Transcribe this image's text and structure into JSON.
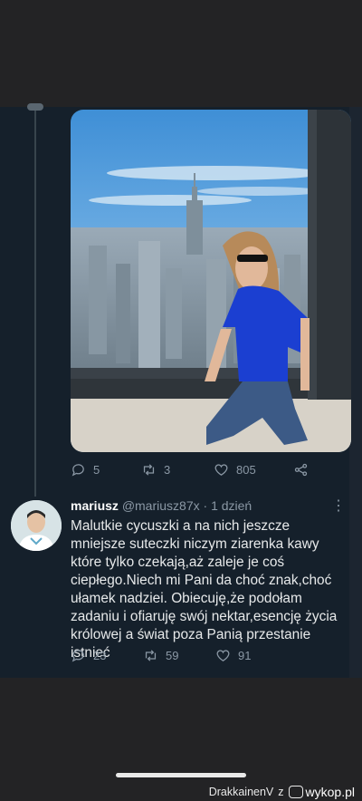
{
  "tweet_top": {
    "photo_alt": "woman-sitting-at-window-over-city",
    "actions": [
      {
        "icon": "reply-icon",
        "count": "5"
      },
      {
        "icon": "retweet-icon",
        "count": "3"
      },
      {
        "icon": "like-icon",
        "count": "805"
      },
      {
        "icon": "share-icon",
        "count": ""
      }
    ]
  },
  "tweet_reply": {
    "name": "mariusz",
    "handle": "@mariusz87x",
    "separator": " · ",
    "time": "1 dzień",
    "more": "⋮",
    "text": "Malutkie cycuszki a na nich jeszcze mniejsze suteczki niczym ziarenka kawy które tylko czekają,aż zaleje je coś ciepłego.Niech mi Pani da choć znak,choć ułamek nadziei. Obiecuję,że podołam zadaniu i ofiaruję swój nektar,esencję życia królowej a świat poza Panią przestanie istnieć",
    "actions": [
      {
        "icon": "reply-icon",
        "count": "23"
      },
      {
        "icon": "retweet-icon",
        "count": "59"
      },
      {
        "icon": "like-icon",
        "count": "91"
      }
    ]
  },
  "watermark": {
    "user": "DrakkainenV",
    "connector": "z",
    "site": "wykop.pl"
  },
  "colors": {
    "feed_bg": "#15202b",
    "frame_bg": "#232325",
    "muted": "#8b98a5"
  }
}
